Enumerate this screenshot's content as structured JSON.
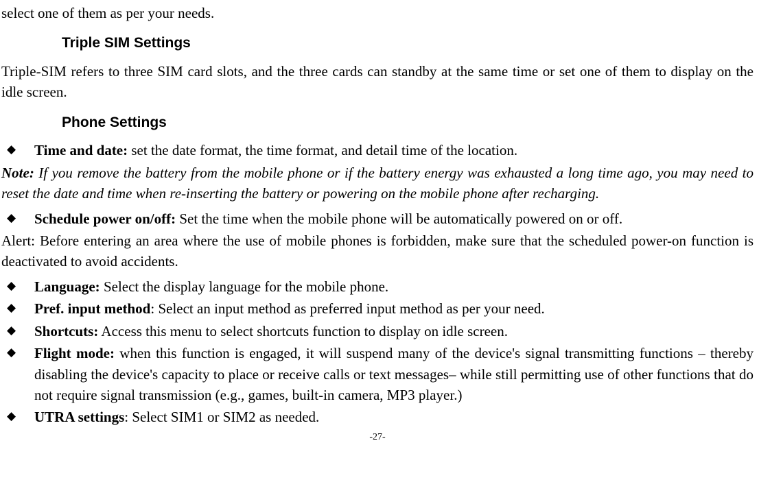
{
  "intro": "select one of them as per your needs.",
  "sections": {
    "triple_sim": {
      "heading": "Triple SIM Settings",
      "body": "Triple-SIM refers to three SIM card slots, and the three cards can standby at the same time or set one of them to display on the idle screen."
    },
    "phone": {
      "heading": "Phone Settings",
      "items": {
        "time_date": {
          "label": "Time and date:",
          "text": " set the date format, the time format, and detail time of the location."
        },
        "note": {
          "label": "Note:",
          "text": " If you remove the battery from the mobile phone or if the battery energy was exhausted a long time ago, you may need to reset the date and time when re-inserting the battery or powering on the mobile phone after recharging."
        },
        "schedule": {
          "label": "Schedule power on/off:",
          "text": " Set the time when the mobile phone will be automatically powered on or off."
        },
        "alert": "Alert: Before entering an area where the use of mobile phones is forbidden, make sure that the scheduled power-on function is deactivated to avoid accidents.",
        "language": {
          "label": "Language:",
          "text": " Select the display language for the mobile phone."
        },
        "pref_input": {
          "label": "Pref. input method",
          "text": ": Select an input method as preferred input method as per your need."
        },
        "shortcuts": {
          "label": "Shortcuts:",
          "text": " Access this menu to select shortcuts function to display on idle screen."
        },
        "flight": {
          "label": "Flight mode:",
          "text": " when this function is engaged, it will suspend many of the device's signal transmitting functions – thereby disabling the device's capacity to place or receive calls or text messages– while still permitting use of other functions that do not require signal transmission (e.g., games, built-in camera, MP3 player.)"
        },
        "utra": {
          "label": "UTRA settings",
          "text": ": Select SIM1 or SIM2 as needed."
        }
      }
    }
  },
  "page_number": "-27-"
}
